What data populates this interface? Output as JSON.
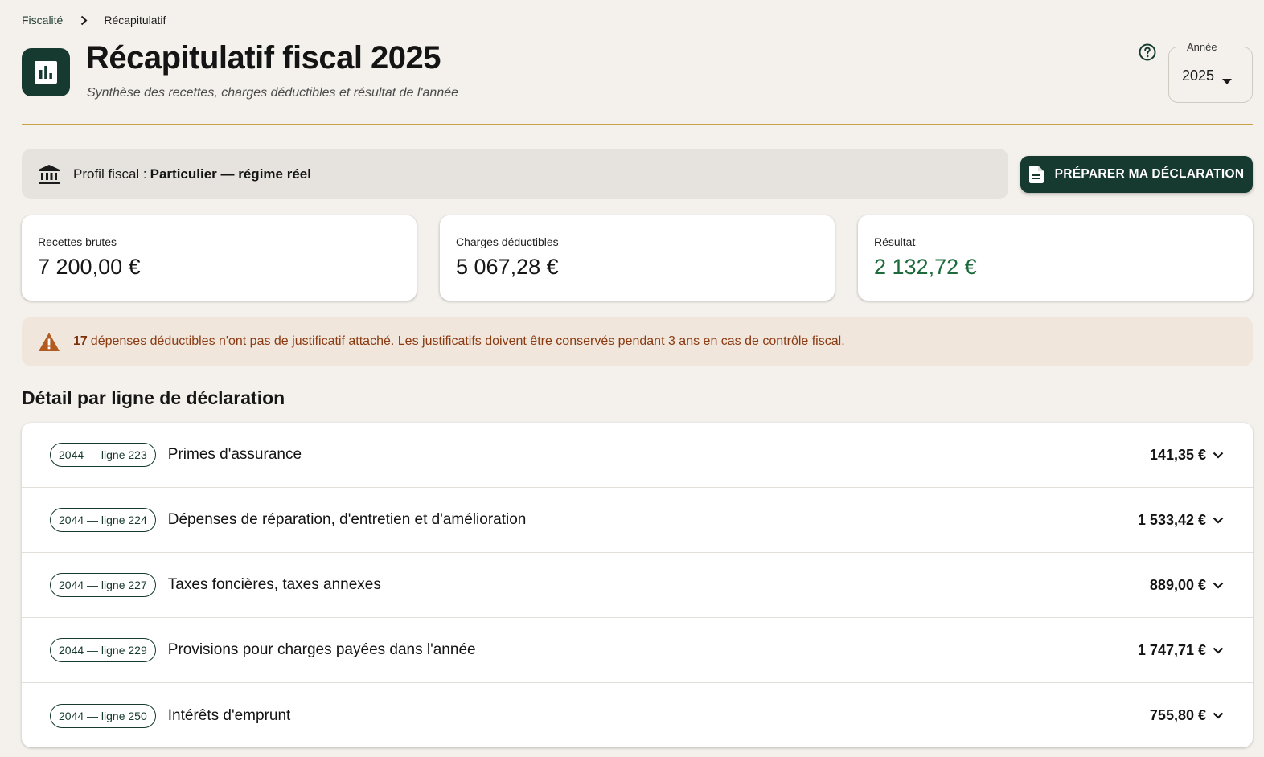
{
  "breadcrumb": {
    "parent": "Fiscalité",
    "current": "Récapitulatif"
  },
  "header": {
    "title": "Récapitulatif fiscal 2025",
    "subtitle": "Synthèse des recettes, charges déductibles et résultat de l'année",
    "year_label": "Année",
    "year_value": "2025"
  },
  "profile": {
    "label": "Profil fiscal :",
    "value": "Particulier — régime réel"
  },
  "actions": {
    "prepare_label": "PRÉPARER MA DÉCLARATION"
  },
  "stats": [
    {
      "label": "Recettes brutes",
      "value": "7 200,00 €"
    },
    {
      "label": "Charges déductibles",
      "value": "5 067,28 €"
    },
    {
      "label": "Résultat",
      "value": "2 132,72 €"
    }
  ],
  "alert": {
    "count": "17",
    "text": "dépenses déductibles n'ont pas de justificatif attaché. Les justificatifs doivent être conservés pendant 3 ans en cas de contrôle fiscal."
  },
  "detail": {
    "title": "Détail par ligne de déclaration",
    "lines": [
      {
        "chip": "2044 — ligne 223",
        "label": "Primes d'assurance",
        "amount": "141,35 €"
      },
      {
        "chip": "2044 — ligne 224",
        "label": "Dépenses de réparation, d'entretien et d'amélioration",
        "amount": "1 533,42 €"
      },
      {
        "chip": "2044 — ligne 227",
        "label": "Taxes foncières, taxes annexes",
        "amount": "889,00 €"
      },
      {
        "chip": "2044 — ligne 229",
        "label": "Provisions pour charges payées dans l'année",
        "amount": "1 747,71 €"
      },
      {
        "chip": "2044 — ligne 250",
        "label": "Intérêts d'emprunt",
        "amount": "755,80 €"
      }
    ]
  },
  "colors": {
    "brand": "#173a30",
    "accent_line": "#c9a24a",
    "positive": "#1d6b3c",
    "warning": "#b35a1f"
  }
}
